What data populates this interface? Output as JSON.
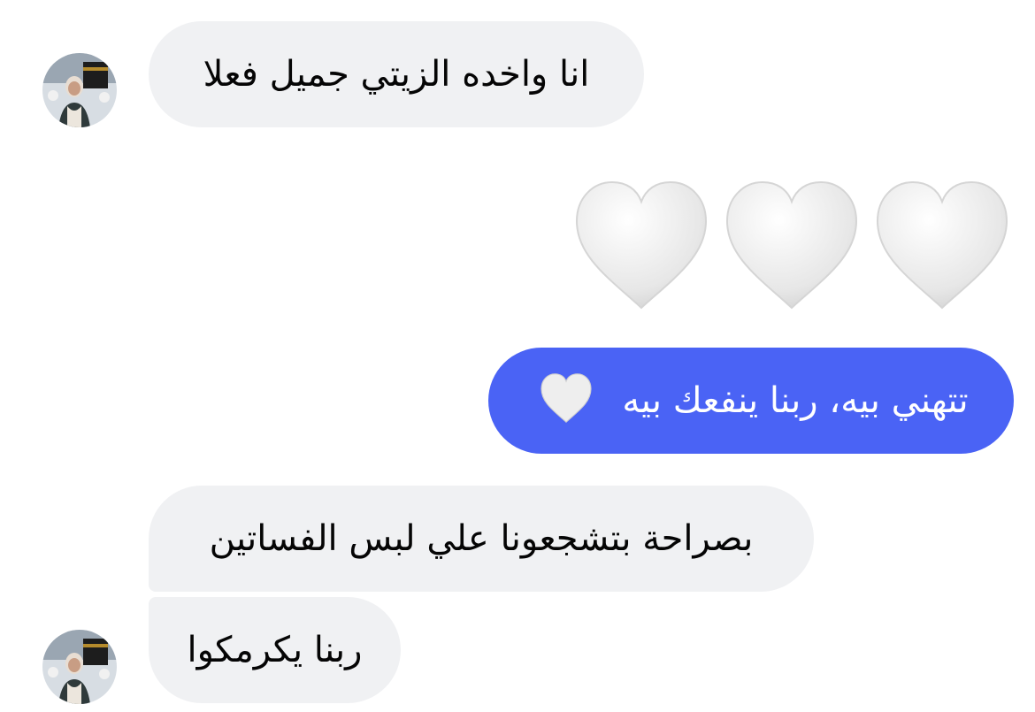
{
  "messages": [
    {
      "text": "انا واخده الزيتي جميل فعلا"
    },
    {
      "emoji": "🤍🤍🤍"
    },
    {
      "text": "تتهني بيه، ربنا ينفعك بيه"
    },
    {
      "text": "بصراحة بتشجعونا علي لبس الفساتين"
    },
    {
      "text": "ربنا يكرمكوا"
    }
  ],
  "colors": {
    "incoming_bubble": "#f0f1f3",
    "outgoing_bubble": "#4a63f5",
    "heart": "#e9e9e9"
  }
}
